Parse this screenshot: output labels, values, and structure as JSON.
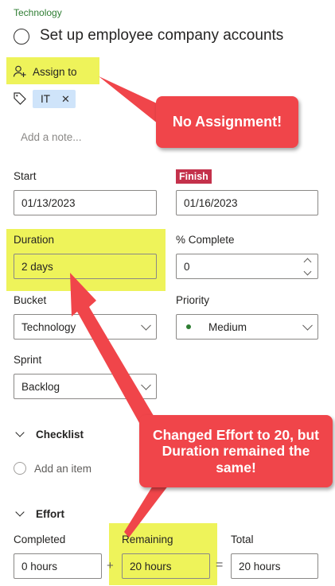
{
  "task": {
    "bucket_tag": "Technology",
    "title": "Set up employee company accounts",
    "assign_label": "Assign to",
    "label_chip": "IT",
    "note_placeholder": "Add a note..."
  },
  "dates": {
    "start_label": "Start",
    "start_value": "01/13/2023",
    "finish_label": "Finish",
    "finish_value": "01/16/2023"
  },
  "duration": {
    "label": "Duration",
    "value": "2 days"
  },
  "complete": {
    "label": "% Complete",
    "value": "0"
  },
  "bucket": {
    "label": "Bucket",
    "value": "Technology"
  },
  "priority": {
    "label": "Priority",
    "value": "Medium"
  },
  "sprint": {
    "label": "Sprint",
    "value": "Backlog"
  },
  "checklist": {
    "label": "Checklist",
    "add_item": "Add an item"
  },
  "effort": {
    "label": "Effort",
    "completed_label": "Completed",
    "completed_value": "0 hours",
    "remaining_label": "Remaining",
    "remaining_value": "20 hours",
    "total_label": "Total",
    "total_value": "20 hours",
    "plus": "+",
    "equals": "="
  },
  "callouts": {
    "no_assignment": "No Assignment!",
    "effort_note": "Changed Effort to 20, but Duration remained the same!"
  },
  "colors": {
    "highlight": "#eef35a",
    "callout": "#f0454a",
    "tag_green": "#2e7d32",
    "finish_badge": "#c4314b",
    "chip_bg": "#cfe4fa"
  }
}
